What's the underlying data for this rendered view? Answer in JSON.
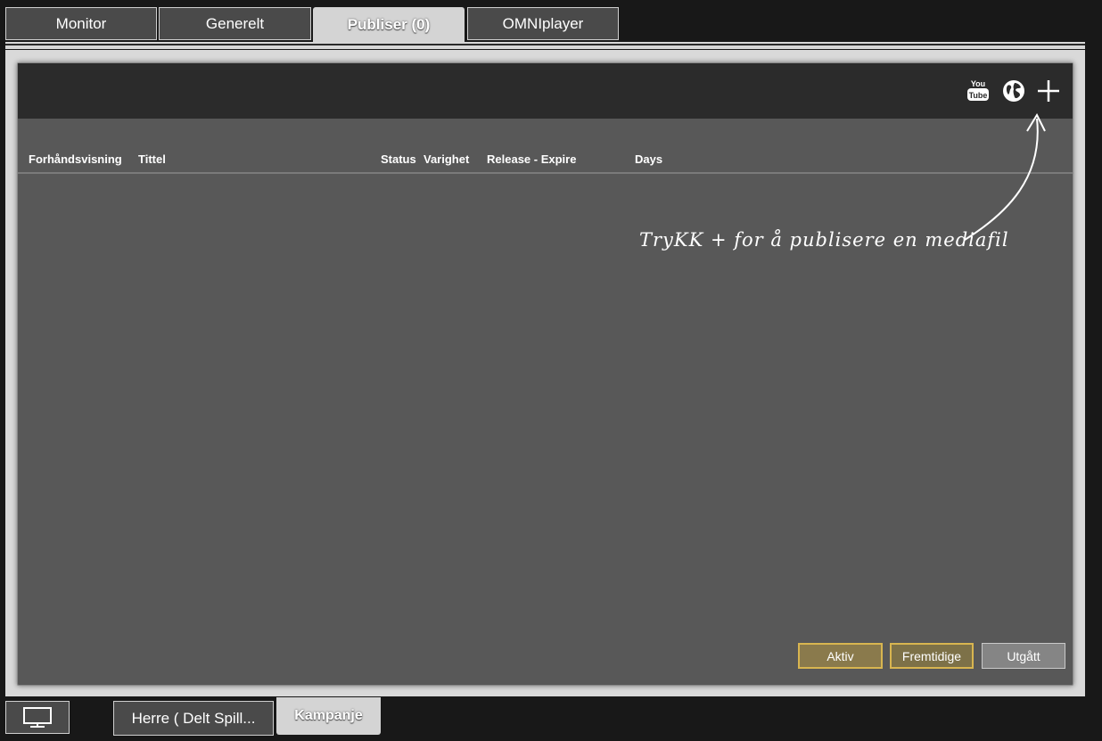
{
  "top_tabs": [
    {
      "label": "Monitor"
    },
    {
      "label": "Generelt"
    },
    {
      "label": "Publiser (0)"
    },
    {
      "label": "OMNIplayer"
    }
  ],
  "toolbar": {
    "icons": [
      "youtube-icon",
      "globe-icon",
      "plus-icon"
    ]
  },
  "columns": [
    "Forhåndsvisning",
    "Tittel",
    "Status",
    "Varighet",
    "Release - Expire",
    "Days"
  ],
  "hint": "TryKK + for å publisere en mediafil",
  "filters": {
    "aktiv": "Aktiv",
    "fremtidige": "Fremtidige",
    "utgatt": "Utgått"
  },
  "bottom_tabs": {
    "monitor_icon": "monitor-icon",
    "herre": "Herre ( Delt Spill...",
    "kampanje": "Kampanje"
  },
  "colors": {
    "background": "#181818",
    "panel": "#585858",
    "toolbar": "#2b2b2b",
    "accent_gold": "#d8b550",
    "active_tab": "#d4d4d4"
  }
}
